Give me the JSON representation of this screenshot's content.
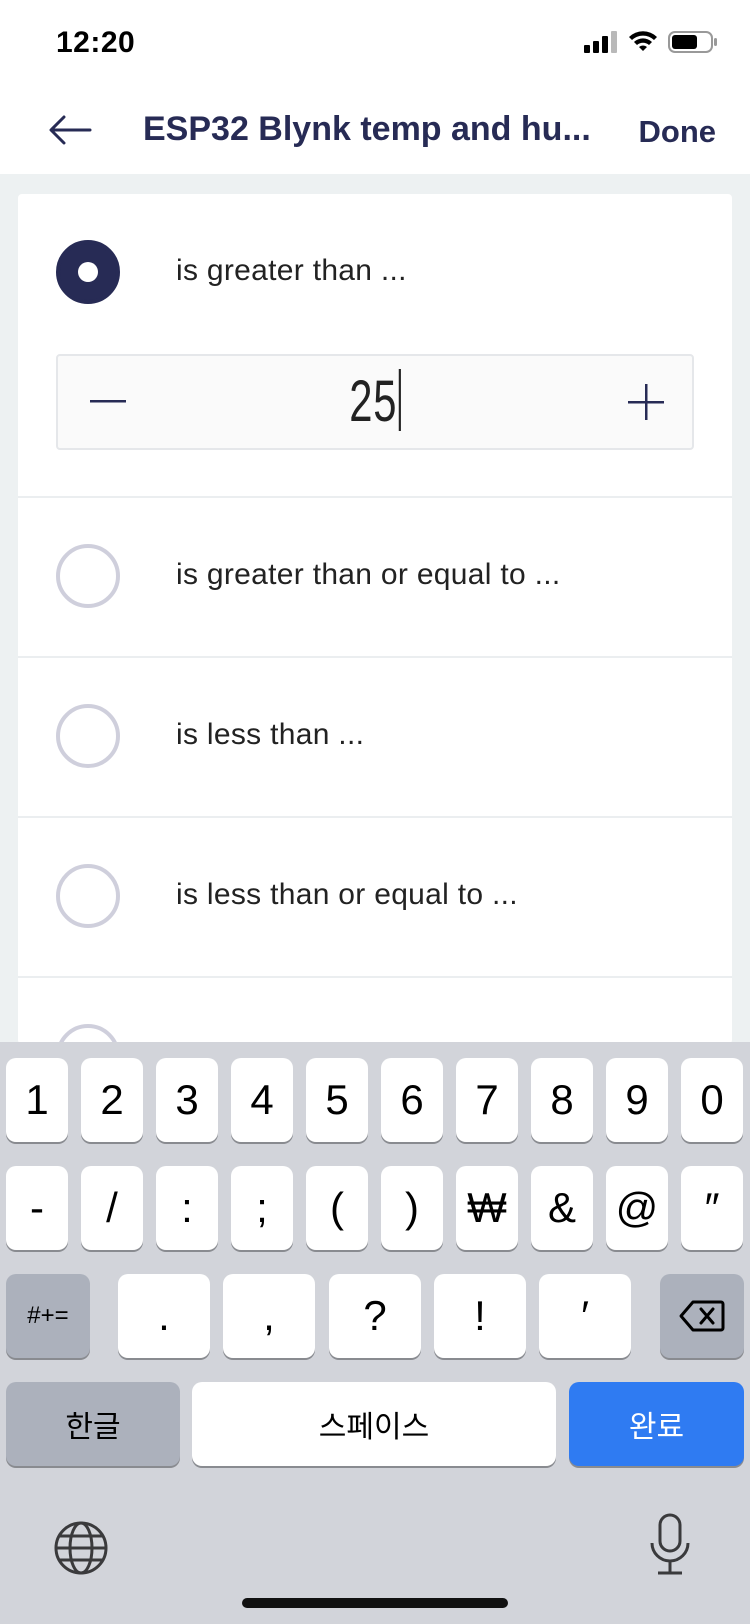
{
  "status_bar": {
    "time": "12:20"
  },
  "nav": {
    "title": "ESP32 Blynk temp and hu...",
    "done_label": "Done"
  },
  "options": [
    {
      "label": "is greater than ...",
      "selected": true
    },
    {
      "label": "is greater than or equal to ...",
      "selected": false
    },
    {
      "label": "is less than ...",
      "selected": false
    },
    {
      "label": "is less than or equal to ...",
      "selected": false
    }
  ],
  "stepper": {
    "value": "25",
    "minus": "−",
    "plus": "+"
  },
  "keyboard": {
    "row1": [
      "1",
      "2",
      "3",
      "4",
      "5",
      "6",
      "7",
      "8",
      "9",
      "0"
    ],
    "row2": [
      "-",
      "/",
      ":",
      ";",
      "(",
      ")",
      "₩",
      "&",
      "@",
      "″"
    ],
    "row3": {
      "mode": "#+=",
      "keys": [
        ".",
        ",",
        "?",
        "!",
        "′"
      ]
    },
    "row4": {
      "lang": "한글",
      "space": "스페이스",
      "done": "완료"
    }
  },
  "colors": {
    "accent": "#272b55",
    "keyboard_done": "#2f7bf2"
  }
}
